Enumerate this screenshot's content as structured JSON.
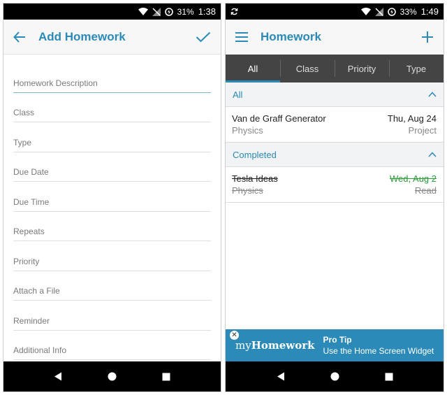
{
  "left_screen": {
    "status": {
      "battery": "31%",
      "time": "1:38"
    },
    "appbar": {
      "title": "Add Homework",
      "back_icon": "arrow-left-icon",
      "confirm_icon": "check-icon"
    },
    "fields": [
      {
        "placeholder": "Homework Description"
      },
      {
        "placeholder": "Class"
      },
      {
        "placeholder": "Type"
      },
      {
        "placeholder": "Due Date"
      },
      {
        "placeholder": "Due Time"
      },
      {
        "placeholder": "Repeats"
      },
      {
        "placeholder": "Priority"
      },
      {
        "placeholder": "Attach a File"
      },
      {
        "placeholder": "Reminder"
      },
      {
        "placeholder": "Additional Info"
      }
    ]
  },
  "right_screen": {
    "status": {
      "battery": "33%",
      "time": "1:49"
    },
    "appbar": {
      "title": "Homework",
      "menu_icon": "hamburger-menu-icon",
      "add_icon": "plus-icon"
    },
    "tabs": [
      "All",
      "Class",
      "Priority",
      "Type"
    ],
    "selected_tab": "All",
    "sections": [
      {
        "header": "All",
        "items": [
          {
            "title": "Van de Graff Generator",
            "class": "Physics",
            "due": "Thu, Aug 24",
            "type": "Project",
            "completed": false
          }
        ]
      },
      {
        "header": "Completed",
        "items": [
          {
            "title": "Tesla Ideas",
            "class": "Physics",
            "due": "Wed, Aug 2",
            "type": "Read",
            "completed": true
          }
        ]
      }
    ],
    "ad": {
      "logo_prefix": "my",
      "logo_brand": "Homework",
      "headline": "Pro Tip",
      "body": "Use the Home Screen Widget"
    }
  },
  "colors": {
    "accent": "#2b8ab8",
    "tabs_bg": "#444444",
    "completed_due": "#2e9c3c"
  }
}
